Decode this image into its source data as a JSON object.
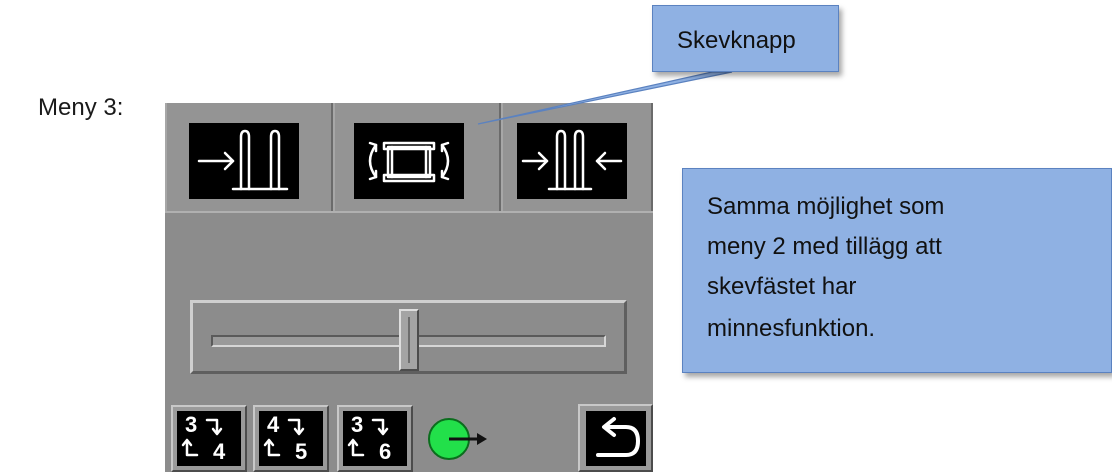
{
  "menu_label": "Meny 3:",
  "callouts": {
    "top": "Skevknapp",
    "side_lines": [
      "Samma möjlighet som",
      "meny 2 med tillägg att",
      "skevfästet har",
      "minnesfunktion."
    ]
  },
  "screen": {
    "top_buttons": [
      {
        "name": "move-right-icon"
      },
      {
        "name": "tilt-rotate-icon"
      },
      {
        "name": "squeeze-in-icon"
      }
    ],
    "slider": {
      "position": 0.5
    },
    "menu_buttons": [
      {
        "top": "3",
        "bottom": "4"
      },
      {
        "top": "4",
        "bottom": "5"
      },
      {
        "top": "3",
        "bottom": "6"
      }
    ],
    "status_indicator_color": "#22e04a",
    "back_icon": "return-arrow-icon"
  },
  "colors": {
    "callout_fill": "#8fb1e3",
    "screen_gray": "#8c8c8c"
  }
}
